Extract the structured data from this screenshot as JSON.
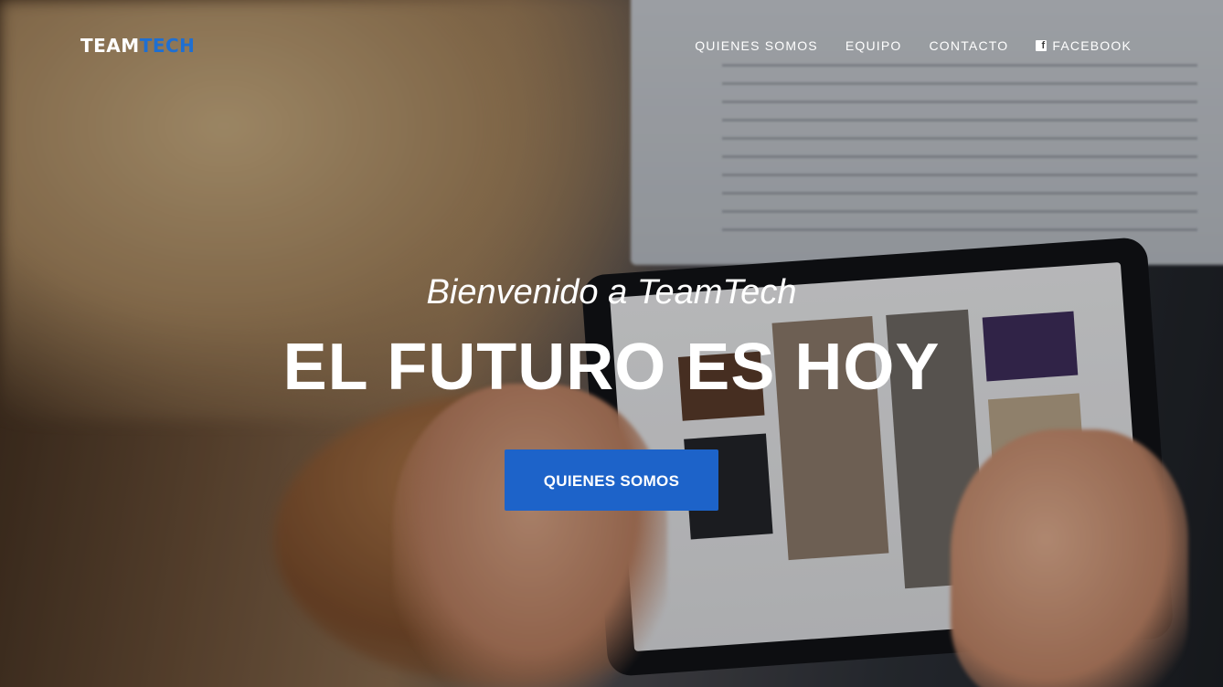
{
  "nav": {
    "brand_main": "TEAM",
    "brand_accent": "TECH",
    "links": [
      {
        "label": "QUIENES SOMOS"
      },
      {
        "label": "EQUIPO"
      },
      {
        "label": "CONTACTO"
      },
      {
        "label": "FACEBOOK",
        "icon": "facebook-icon"
      }
    ]
  },
  "hero": {
    "subtitle": "Bienvenido a TeamTech",
    "title": "EL FUTURO ES HOY",
    "button_label": "QUIENES SOMOS"
  },
  "colors": {
    "accent": "#1d63c9",
    "text": "#ffffff"
  }
}
